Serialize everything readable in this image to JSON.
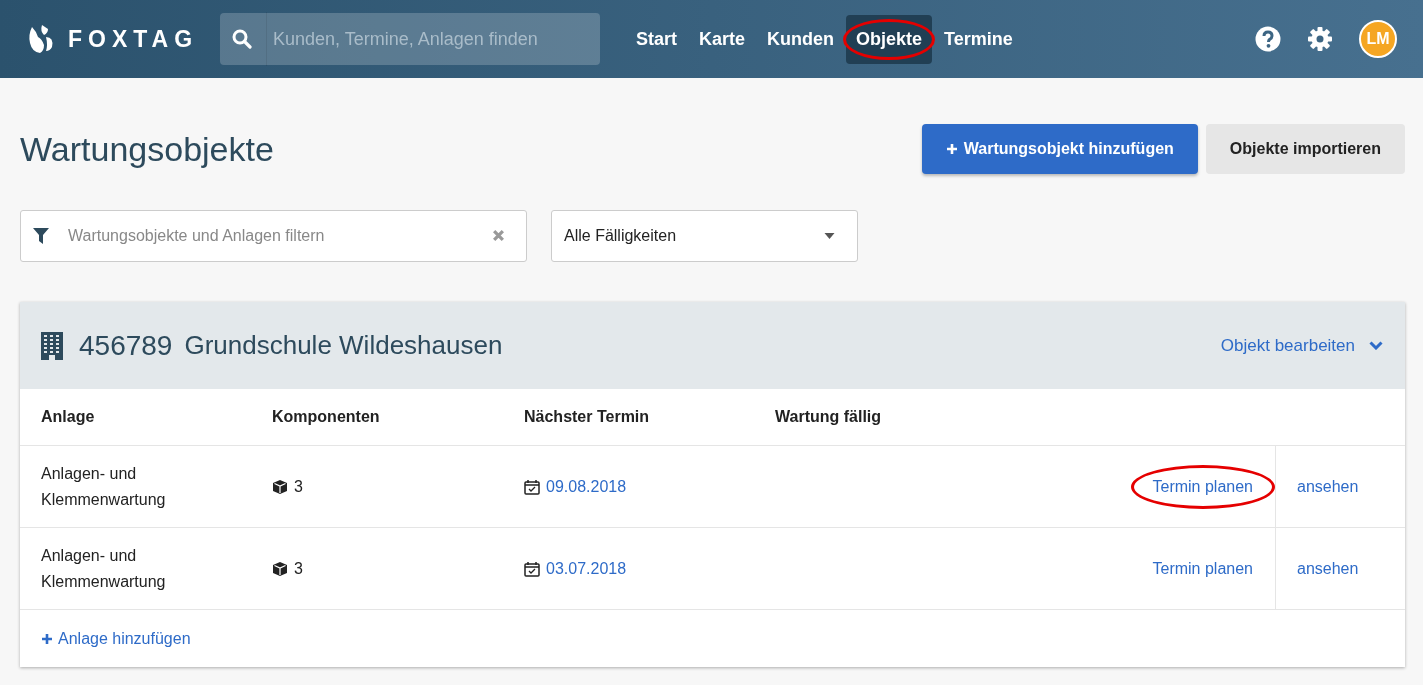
{
  "header": {
    "logo": "FOXTAG",
    "search": {
      "placeholder": "Kunden, Termine, Anlagen finden"
    },
    "nav": [
      {
        "label": "Start",
        "selected": false,
        "highlighted": false
      },
      {
        "label": "Karte",
        "selected": false,
        "highlighted": false
      },
      {
        "label": "Kunden",
        "selected": false,
        "highlighted": false
      },
      {
        "label": "Objekte",
        "selected": true,
        "highlighted": true
      },
      {
        "label": "Termine",
        "selected": false,
        "highlighted": false
      }
    ],
    "avatar": "LM"
  },
  "page": {
    "title": "Wartungsobjekte",
    "buttons": [
      {
        "label": "Wartungsobjekt hinzufügen",
        "kind": "primary"
      },
      {
        "label": "Objekte importieren",
        "kind": "secondary"
      }
    ],
    "filter": {
      "placeholder": "Wartungsobjekte und Anlagen filtern"
    },
    "dropdown": {
      "value": "Alle Fälligkeiten"
    }
  },
  "object": {
    "number": "456789",
    "name": "Grundschule Wildeshausen",
    "edit_link": "Objekt bearbeiten",
    "columns": [
      "Anlage",
      "Komponenten",
      "Nächster Termin",
      "Wartung fällig"
    ],
    "rows": [
      {
        "anlage": "Anlagen- und Klemmenwartung",
        "components": "3",
        "next_date": "09.08.2018",
        "plan": "Termin planen",
        "plan_highlighted": true,
        "view": "ansehen"
      },
      {
        "anlage": "Anlagen- und Klemmenwartung",
        "components": "3",
        "next_date": "03.07.2018",
        "plan": "Termin planen",
        "plan_highlighted": false,
        "view": "ansehen"
      }
    ],
    "add_link": "Anlage hinzufügen"
  }
}
